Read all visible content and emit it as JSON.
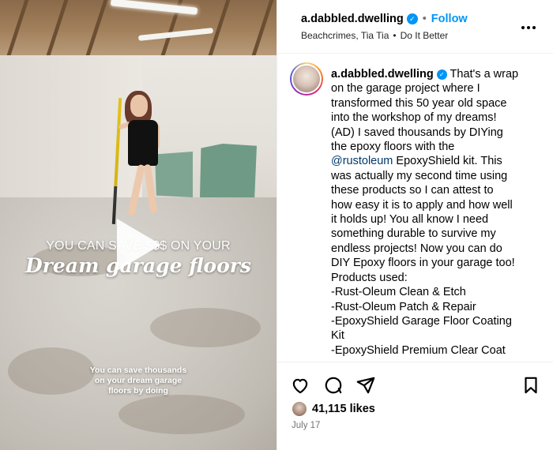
{
  "media": {
    "overlay_line1": "YOU CAN SAVE $$$ ON YOUR",
    "overlay_line2": "Dream garage floors",
    "subtitle_lines": [
      "You can save thousands",
      "on your dream garage",
      "floors by doing"
    ]
  },
  "header": {
    "username": "a.dabbled.dwelling",
    "separator": "•",
    "follow_label": "Follow",
    "audio_left": "Beachcrimes, Tia Tia",
    "audio_sep": "•",
    "audio_right": "Do It Better",
    "more_icon": "..."
  },
  "caption": {
    "username": "a.dabbled.dwelling",
    "line1_tail": "That's a wrap",
    "lines": [
      "on the garage project where I",
      "transformed this 50 year old space",
      "into the workshop of my dreams!",
      "(AD) I saved thousands by DIYing",
      "the epoxy floors with the"
    ],
    "mention": "@rustoleum",
    "mention_tail": " EpoxyShield kit. This",
    "lines2": [
      "was actually my second time using",
      "these products so I can attest to",
      "how easy it is to apply and how well",
      "it holds up! You all know I need",
      "something durable to survive my",
      "endless projects! Now you can do",
      "DIY Epoxy floors in your garage too!",
      "Products used:",
      "-Rust-Oleum Clean & Etch",
      "-Rust-Oleum Patch & Repair",
      "-EpoxyShield Garage Floor Coating",
      "Kit",
      "-EpoxyShield Premium Clear Coat"
    ]
  },
  "actions": {
    "like_icon": "heart-icon",
    "comment_icon": "comment-icon",
    "share_icon": "share-icon",
    "save_icon": "bookmark-icon"
  },
  "likes": {
    "count_text": "41,115 likes"
  },
  "date": "July 17",
  "colors": {
    "link": "#0095f6",
    "mention": "#00376b",
    "muted": "#737373"
  }
}
